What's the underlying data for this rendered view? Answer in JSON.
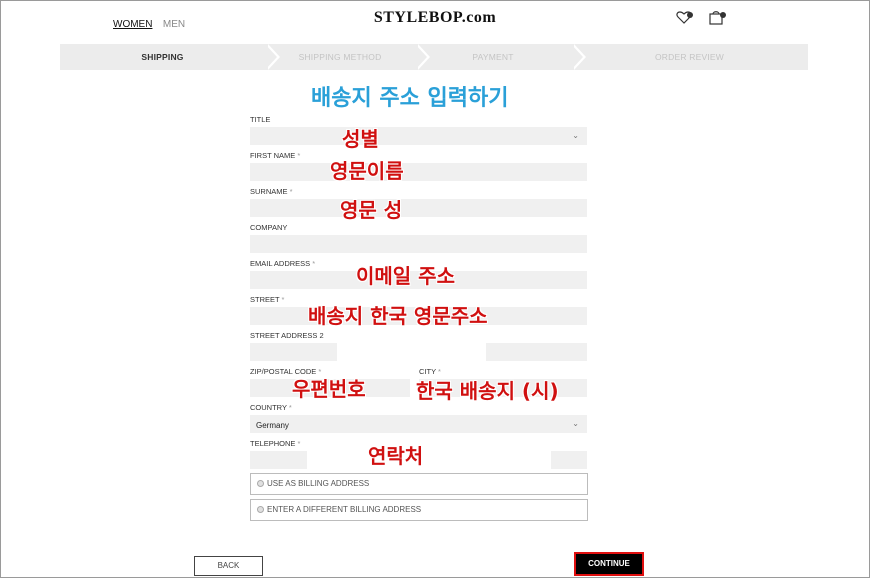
{
  "header": {
    "nav": {
      "women": "WOMEN",
      "men": "MEN"
    },
    "logo": "STYLEBOP.com",
    "icons": [
      "wishlist-heart-icon",
      "shopping-bag-icon"
    ]
  },
  "steps": {
    "shipping": "SHIPPING",
    "shipping_method": "SHIPPING METHOD",
    "payment": "PAYMENT",
    "order_review": "ORDER REVIEW"
  },
  "annotations": {
    "page_title": "배송지 주소 입력하기",
    "title": "성별",
    "first_name": "영문이름",
    "surname": "영문 성",
    "email": "이메일 주소",
    "street": "배송지 한국 영문주소",
    "zip": "우편번호",
    "city": "한국 배송지 (시)",
    "telephone": "연락처"
  },
  "form": {
    "title_label": "TITLE",
    "first_name_label": "FIRST NAME",
    "surname_label": "SURNAME",
    "company_label": "COMPANY",
    "email_label": "EMAIL ADDRESS",
    "street_label": "STREET",
    "street2_label": "STREET ADDRESS 2",
    "zip_label": "ZIP/POSTAL CODE",
    "city_label": "CITY",
    "country_label": "COUNTRY",
    "country_value": "Germany",
    "telephone_label": "TELEPHONE",
    "required_mark": "*"
  },
  "billing_options": {
    "use_as_billing": "USE AS BILLING ADDRESS",
    "different_billing": "ENTER A DIFFERENT BILLING ADDRESS"
  },
  "buttons": {
    "back": "BACK",
    "continue": "CONTINUE"
  },
  "colors": {
    "annotation_red": "#d01010",
    "annotation_blue": "#2aa0d8",
    "continue_bg": "#000000",
    "continue_border": "#e01010"
  }
}
